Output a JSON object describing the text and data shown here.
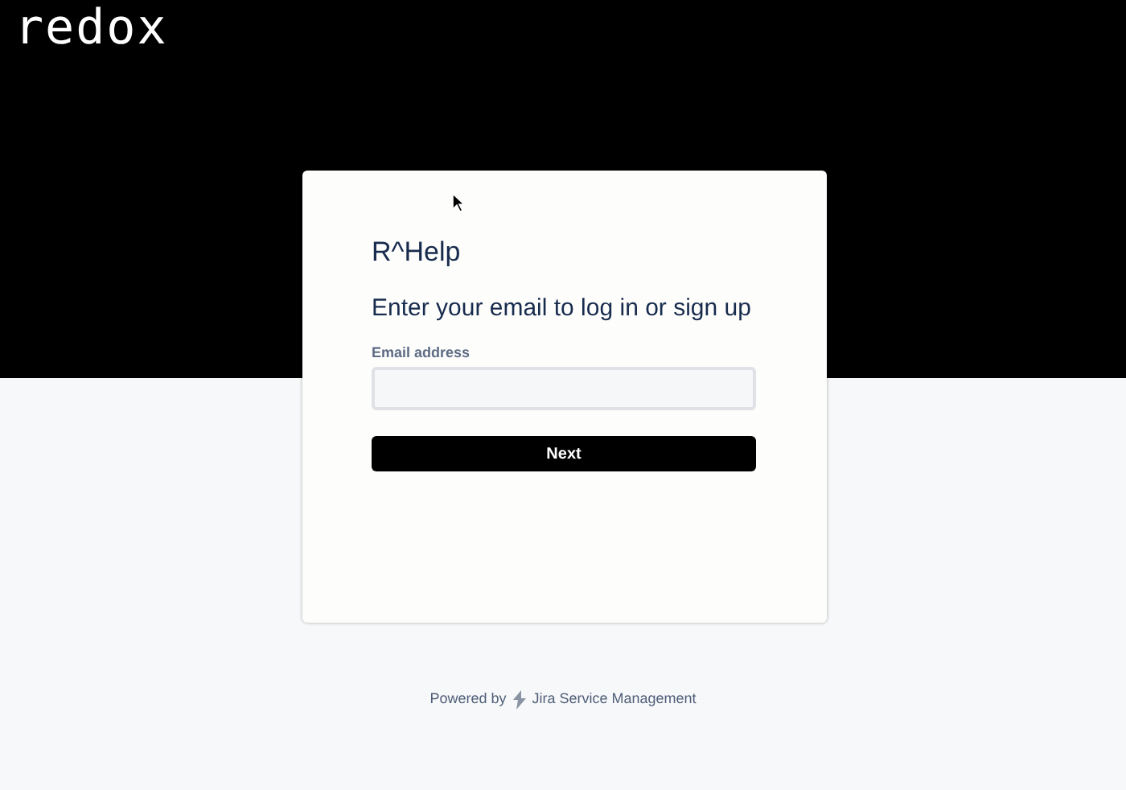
{
  "logo": "redox",
  "card": {
    "site_title": "R^Help",
    "heading": "Enter your email to log in or sign up",
    "email_label": "Email address",
    "button": "Next"
  },
  "footer": {
    "prefix": "Powered by",
    "product": "Jira Service Management"
  }
}
